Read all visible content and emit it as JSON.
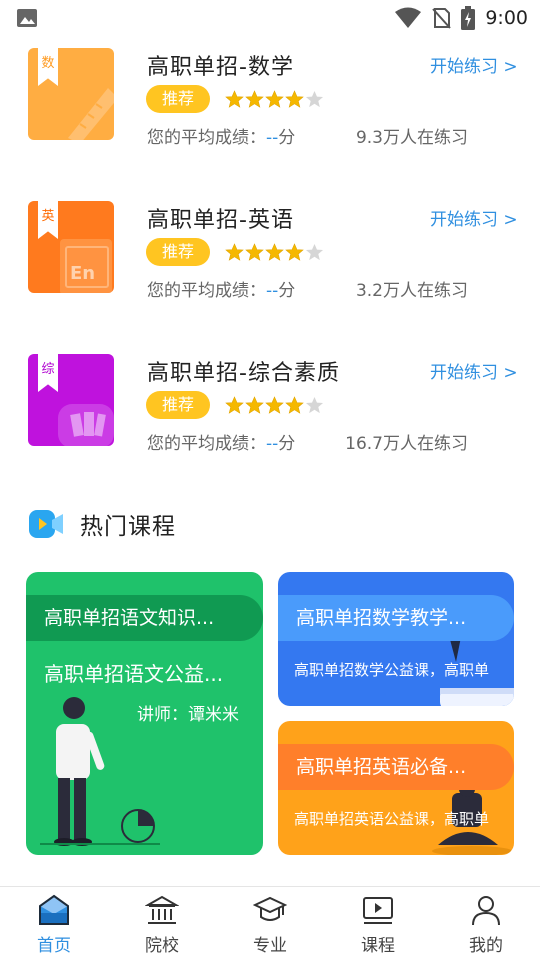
{
  "status_bar": {
    "time": "9:00"
  },
  "courses": [
    {
      "title": "高职单招-数学",
      "tag": "数",
      "action": "开始练习 >",
      "badge": "推荐",
      "rating": 4,
      "avg_label": "您的平均成绩：",
      "avg_value": "--",
      "avg_unit": "分",
      "practice": "9.3万人在练习",
      "cover_color": "#ffad42",
      "tag_color": "#ff9a1f"
    },
    {
      "title": "高职单招-英语",
      "tag": "英",
      "action": "开始练习 >",
      "badge": "推荐",
      "rating": 4,
      "avg_label": "您的平均成绩：",
      "avg_value": "--",
      "avg_unit": "分",
      "practice": "3.2万人在练习",
      "cover_color": "#ff7a1e",
      "tag_color": "#ff6a00"
    },
    {
      "title": "高职单招-综合素质",
      "tag": "综",
      "action": "开始练习 >",
      "badge": "推荐",
      "rating": 4,
      "avg_label": "您的平均成绩：",
      "avg_value": "--",
      "avg_unit": "分",
      "practice": "16.7万人在练习",
      "cover_color": "#bf12dd",
      "tag_color": "#b000d0"
    }
  ],
  "hot_section": {
    "title": "热门课程"
  },
  "hot_courses": [
    {
      "title": "高职单招语文知识...",
      "subtitle": "高职单招语文公益...",
      "teacher": "讲师：谭米米",
      "color": "#1fc26b"
    },
    {
      "title": "高职单招数学教学...",
      "subtitle": "高职单招数学公益课，高职单",
      "color": "#3478f0"
    },
    {
      "title": "高职单招英语必备...",
      "subtitle": "高职单招英语公益课，高职单",
      "color": "#ffa21a"
    }
  ],
  "nav": {
    "items": [
      {
        "label": "首页",
        "icon": "home-icon",
        "active": true
      },
      {
        "label": "院校",
        "icon": "school-icon",
        "active": false
      },
      {
        "label": "专业",
        "icon": "graduation-cap-icon",
        "active": false
      },
      {
        "label": "课程",
        "icon": "video-play-icon",
        "active": false
      },
      {
        "label": "我的",
        "icon": "person-icon",
        "active": false
      }
    ],
    "active_color": "#2f8fe0"
  }
}
